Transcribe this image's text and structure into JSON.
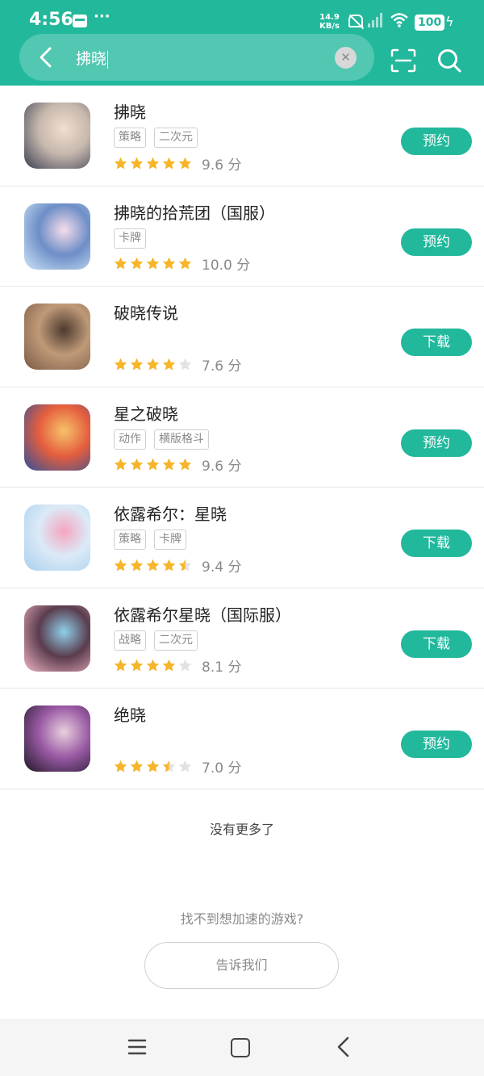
{
  "status_bar": {
    "time": "4:56",
    "more": "···",
    "net_speed_value": "14.9",
    "net_speed_unit": "KB/s",
    "battery": "100"
  },
  "search": {
    "query": "拂晓"
  },
  "colors": {
    "accent": "#22b89c",
    "star": "#f7b529",
    "star_empty": "#e2e2e2"
  },
  "results": [
    {
      "name": "拂晓",
      "tags": [
        "策略",
        "二次元"
      ],
      "rating": 5,
      "score": "9.6 分",
      "action": "预约",
      "icon_colors": [
        "#3a3f52",
        "#c7b8ad",
        "#f1dfcf"
      ]
    },
    {
      "name": "拂晓的拾荒团（国服）",
      "tags": [
        "卡牌"
      ],
      "rating": 5,
      "score": "10.0 分",
      "action": "预约",
      "icon_colors": [
        "#cfe6f8",
        "#6d8ec7",
        "#f6ddeb"
      ]
    },
    {
      "name": "破晓传说",
      "tags": [],
      "rating": 4,
      "score": "7.6 分",
      "action": "下载",
      "icon_colors": [
        "#7a5a45",
        "#bf9a78",
        "#4d3a2f"
      ]
    },
    {
      "name": "星之破晓",
      "tags": [
        "动作",
        "横版格斗"
      ],
      "rating": 5,
      "score": "9.6 分",
      "action": "预约",
      "icon_colors": [
        "#2f4f9b",
        "#e55e3e",
        "#f5c36a"
      ]
    },
    {
      "name": "依露希尔：星晓",
      "tags": [
        "策略",
        "卡牌"
      ],
      "rating": 4.5,
      "score": "9.4 分",
      "action": "下载",
      "icon_colors": [
        "#a9cfee",
        "#dbeaf7",
        "#f6a5c0"
      ]
    },
    {
      "name": "依露希尔星晓（国际服）",
      "tags": [
        "战略",
        "二次元"
      ],
      "rating": 4,
      "score": "8.1 分",
      "action": "下载",
      "icon_colors": [
        "#f3b6c6",
        "#5a3c4d",
        "#8fd0ea"
      ]
    },
    {
      "name": "绝晓",
      "tags": [],
      "rating": 3.5,
      "score": "7.0 分",
      "action": "预约",
      "icon_colors": [
        "#1f1726",
        "#9a5aa5",
        "#e9d0dd"
      ]
    }
  ],
  "footer": {
    "no_more": "没有更多了",
    "hint": "找不到想加速的游戏?",
    "tell_button": "告诉我们"
  }
}
